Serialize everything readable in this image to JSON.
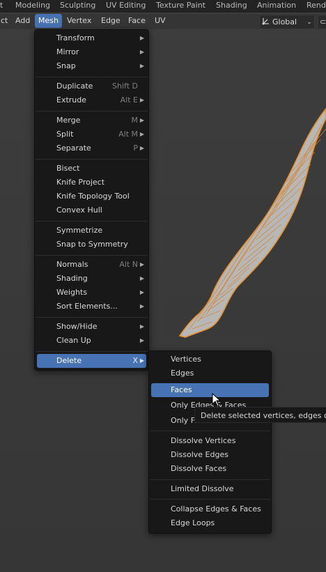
{
  "workspace_tabs": [
    "t",
    "Modeling",
    "Sculpting",
    "UV Editing",
    "Texture Paint",
    "Shading",
    "Animation",
    "Rende"
  ],
  "header": {
    "items": [
      "ct",
      "Add",
      "Mesh",
      "Vertex",
      "Edge",
      "Face",
      "UV"
    ],
    "active": "Mesh",
    "orientation_label": "Global"
  },
  "mesh_menu": {
    "items": [
      {
        "label": "Transform",
        "shortcut": "",
        "submenu": true
      },
      {
        "label": "Mirror",
        "shortcut": "",
        "submenu": true
      },
      {
        "label": "Snap",
        "shortcut": "",
        "submenu": true
      },
      {
        "label": "Duplicate",
        "shortcut": "Shift D",
        "submenu": false
      },
      {
        "label": "Extrude",
        "shortcut": "Alt E",
        "submenu": true
      },
      {
        "label": "Merge",
        "shortcut": "M",
        "submenu": true
      },
      {
        "label": "Split",
        "shortcut": "Alt M",
        "submenu": true
      },
      {
        "label": "Separate",
        "shortcut": "P",
        "submenu": true
      },
      {
        "label": "Bisect",
        "shortcut": "",
        "submenu": false
      },
      {
        "label": "Knife Project",
        "shortcut": "",
        "submenu": false
      },
      {
        "label": "Knife Topology Tool",
        "shortcut": "",
        "submenu": false
      },
      {
        "label": "Convex Hull",
        "shortcut": "",
        "submenu": false
      },
      {
        "label": "Symmetrize",
        "shortcut": "",
        "submenu": false
      },
      {
        "label": "Snap to Symmetry",
        "shortcut": "",
        "submenu": false
      },
      {
        "label": "Normals",
        "shortcut": "Alt N",
        "submenu": true
      },
      {
        "label": "Shading",
        "shortcut": "",
        "submenu": true
      },
      {
        "label": "Weights",
        "shortcut": "",
        "submenu": true
      },
      {
        "label": "Sort Elements...",
        "shortcut": "",
        "submenu": true
      },
      {
        "label": "Show/Hide",
        "shortcut": "",
        "submenu": true
      },
      {
        "label": "Clean Up",
        "shortcut": "",
        "submenu": true
      },
      {
        "label": "Delete",
        "shortcut": "X",
        "submenu": true,
        "highlighted": true
      }
    ]
  },
  "delete_menu": {
    "items": [
      {
        "label": "Vertices"
      },
      {
        "label": "Edges"
      },
      {
        "label": "Faces",
        "highlighted": true
      },
      {
        "label": "Only Edges & Faces"
      },
      {
        "label": "Only Faces"
      },
      {
        "label": "Dissolve Vertices"
      },
      {
        "label": "Dissolve Edges"
      },
      {
        "label": "Dissolve Faces"
      },
      {
        "label": "Limited Dissolve"
      },
      {
        "label": "Collapse Edges & Faces"
      },
      {
        "label": "Edge Loops"
      }
    ]
  },
  "tooltip": {
    "text": "Delete selected vertices, edges or faces"
  },
  "icons": {
    "orientation": "transform-orientation-icon",
    "snap": "snap-magnet-icon",
    "submenu": "submenu-arrow-icon",
    "cursor": "mouse-cursor-icon"
  },
  "colors": {
    "highlight": "#4772b3",
    "menu_bg": "#181818",
    "mesh_wire": "#e8902a",
    "mesh_fill": "#b5b5b5"
  }
}
